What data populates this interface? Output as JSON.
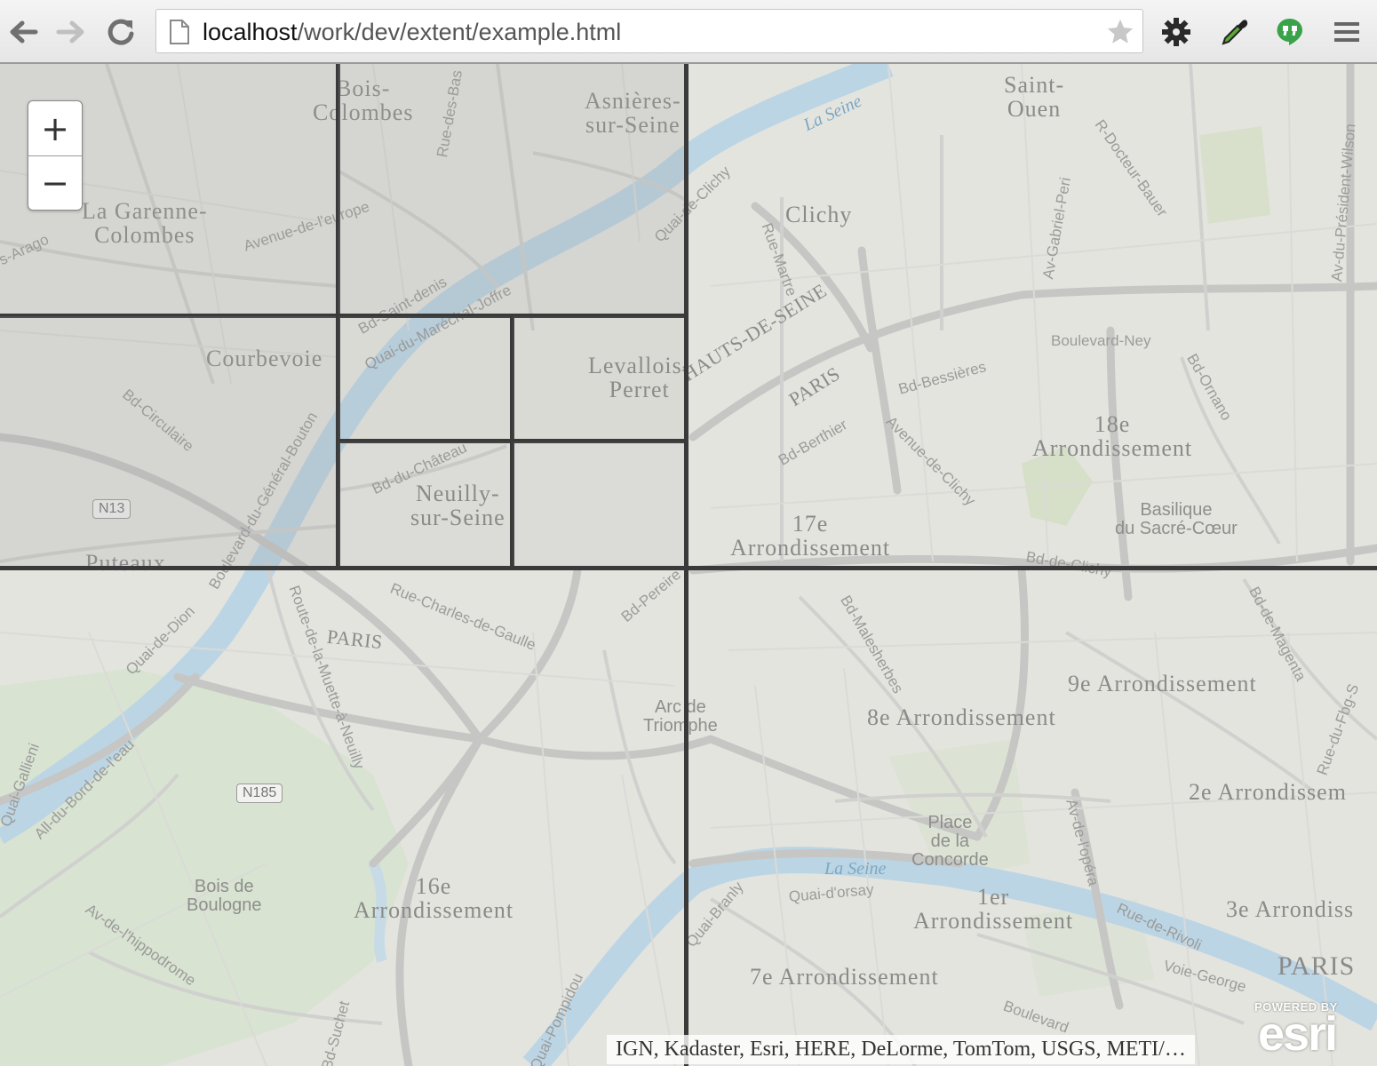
{
  "browser": {
    "url_host": "localhost",
    "url_path": "/work/dev/extent/example.html"
  },
  "map": {
    "zoom_in_label": "+",
    "zoom_out_label": "−",
    "attribution": "IGN, Kadaster, Esri, HERE, DeLorme, TomTom, USGS, METI/…",
    "logo_powered_by": "POWERED BY",
    "logo_text": "esri",
    "labels": {
      "bois_colombes": "Bois-\nColombes",
      "asnieres": "Asnières-\nsur-Seine",
      "saint_ouen": "Saint-\nOuen",
      "clichy": "Clichy",
      "la_garenne": "La Garenne-\nColombes",
      "courbevoie": "Courbevoie",
      "levallois": "Levallois-\nPerret",
      "neuilly": "Neuilly-\nsur-Seine",
      "puteaux": "Puteaux",
      "hauts_de_seine": "HAUTS-DE-SEINE",
      "paris_rot": "PARIS",
      "arr18": "18e\nArrondissement",
      "arr17": "17e\nArrondissement",
      "basilique": "Basilique\ndu Sacré-Cœur",
      "paris_top": "PARIS",
      "arc": "Arc de\nTriomphe",
      "arr9": "9e Arrondissement",
      "arr8": "8e Arrondissement",
      "arr2": "2e Arrondissem",
      "bois_boulogne": "Bois de\nBoulogne",
      "arr16": "16e\nArrondissement",
      "place_concorde": "Place\nde la\nConcorde",
      "la_seine": "La Seine",
      "arr1": "1er\nArrondissement",
      "arr3": "3e Arrondiss",
      "paris_big": "PARIS",
      "arr7": "7e Arrondissement",
      "la_seine_top": "La Seine"
    },
    "shields": {
      "n13": "N13",
      "n185": "N185"
    },
    "streets": {
      "rue_des_bas": "Rue-des-Bas",
      "av_europe": "Avenue-de-l'europe",
      "quai_clichy": "Quai-de-Clichy",
      "rue_martre": "Rue-Martre",
      "av_gabriel_peri": "Av-Gabriel-Peri",
      "r_docteur_bauer": "R-Docteur-Bauer",
      "av_president_wilson": "Av-du-Président-Wilson",
      "bd_saint_denis": "Bd-Saint-denis",
      "quai_marechal_joffre": "Quai-du-Maréchal-Joffre",
      "boulevard_ney": "Boulevard-Ney",
      "bd_bessieres": "Bd-Bessières",
      "bd_ornano": "Bd-Ornano",
      "bd_berthier": "Bd-Berthier",
      "av_clichy": "Avenue-de-Clichy",
      "bd_circulaire": "Bd-Circulaire",
      "bd_general": "Boulevard-du-Général-Bouton",
      "bd_chateau": "Bd-du-Château",
      "bd_clichy": "Bd-de-Clichy",
      "rue_charles": "Rue-Charles-de-Gaulle",
      "route_muette": "Route-de-la-Muette-à-Neuilly",
      "quai_dion": "Quai-de-Dion",
      "bd_malesherbes": "Bd-Malesherbes",
      "bd_magenta": "Bd-de-Magenta",
      "av_opera": "Av-de-l'opéra",
      "rue_rivoli": "Rue-de-Rivoli",
      "quai_orsay": "Quai-d'orsay",
      "quai_branly": "Quai-Branly",
      "av_hippodrome": "Av-de-l'hippodrome",
      "all_bord": "All-du-Bord-de-l'eau",
      "quai_gallieni": "Quai-Gallieni",
      "bd_suchet": "Bd-Suchet",
      "voie_george": "Voie-George",
      "boulevard_bottom": "Boulevard",
      "bd_pereire": "Bd-Pereire",
      "rue_fbg": "Rue-du-Fbg-S",
      "s_arago": "s-Arago",
      "quai_pompidou": "Quai-Pompidou"
    }
  },
  "colors": {
    "extent_border": "#3a3a3a",
    "water": "#b8d4e4",
    "park": "#d7e4d0",
    "road": "#c2c2c0"
  }
}
